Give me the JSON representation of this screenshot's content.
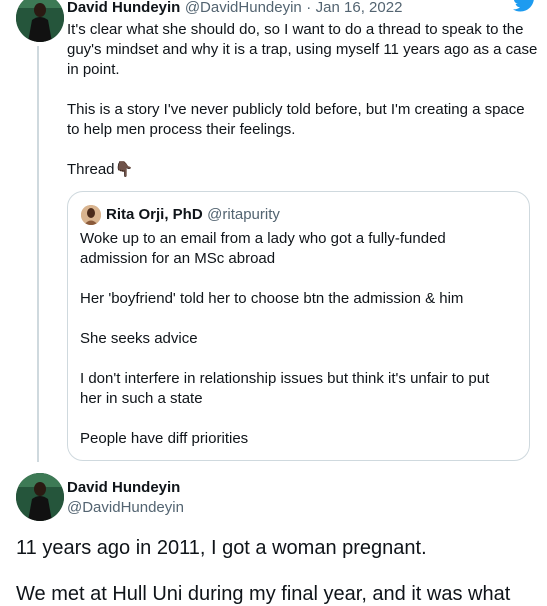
{
  "tweet1": {
    "name": "David Hundeyin",
    "handle": "@DavidHundeyin",
    "separator": "·",
    "date": "Jan 16, 2022",
    "lines": [
      "It's clear what she should do, so I want to do a thread to speak to the",
      "guy's mindset and why it is a trap, using myself 11 years ago as a case",
      "in point.",
      "This is a story I've never publicly told before, but I'm creating a space",
      "to help men process their feelings.",
      "Thread"
    ],
    "thread_emoji": "👇🏿"
  },
  "quote": {
    "name": "Rita Orji, PhD",
    "handle": "@ritapurity",
    "lines": [
      "Woke up to an email from a lady who got a fully-funded",
      "admission for an MSc abroad",
      "Her 'boyfriend' told her to choose btn the admission & him",
      "She seeks advice",
      "I don't interfere in relationship issues but think it's unfair to put",
      "her in such a state",
      "People have diff priorities"
    ]
  },
  "tweet2": {
    "name": "David Hundeyin",
    "handle": "@DavidHundeyin",
    "lines": [
      "11 years ago in 2011, I got a woman pregnant.",
      "We met at Hull Uni during my final year, and it was what"
    ]
  },
  "colors": {
    "brand": "#1d9bf0",
    "text": "#0f1419",
    "muted": "#536471",
    "border": "#cfd9de"
  },
  "icons": [
    "twitter-bird-icon",
    "avatar",
    "pointing-down-emoji"
  ]
}
